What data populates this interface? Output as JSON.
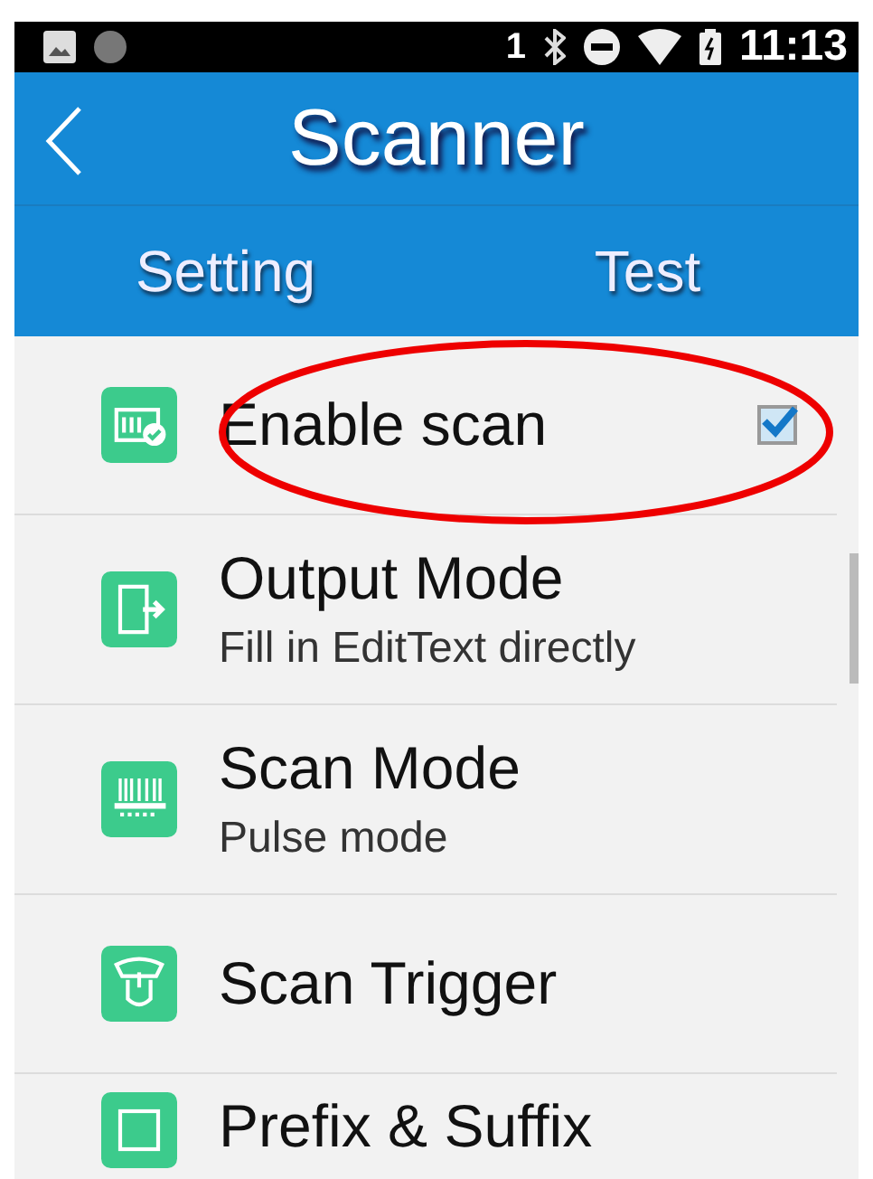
{
  "status_bar": {
    "sim_slot": "1",
    "time": "11:13"
  },
  "header": {
    "title": "Scanner"
  },
  "tabs": [
    {
      "label": "Setting"
    },
    {
      "label": "Test"
    }
  ],
  "items": [
    {
      "kind": "checkbox",
      "title": "Enable scan",
      "checked": true
    },
    {
      "kind": "nav",
      "title": "Output Mode",
      "subtitle": "Fill in EditText directly"
    },
    {
      "kind": "nav",
      "title": "Scan Mode",
      "subtitle": "Pulse mode"
    },
    {
      "kind": "nav",
      "title": "Scan Trigger"
    },
    {
      "kind": "nav",
      "title": "Prefix & Suffix"
    }
  ]
}
